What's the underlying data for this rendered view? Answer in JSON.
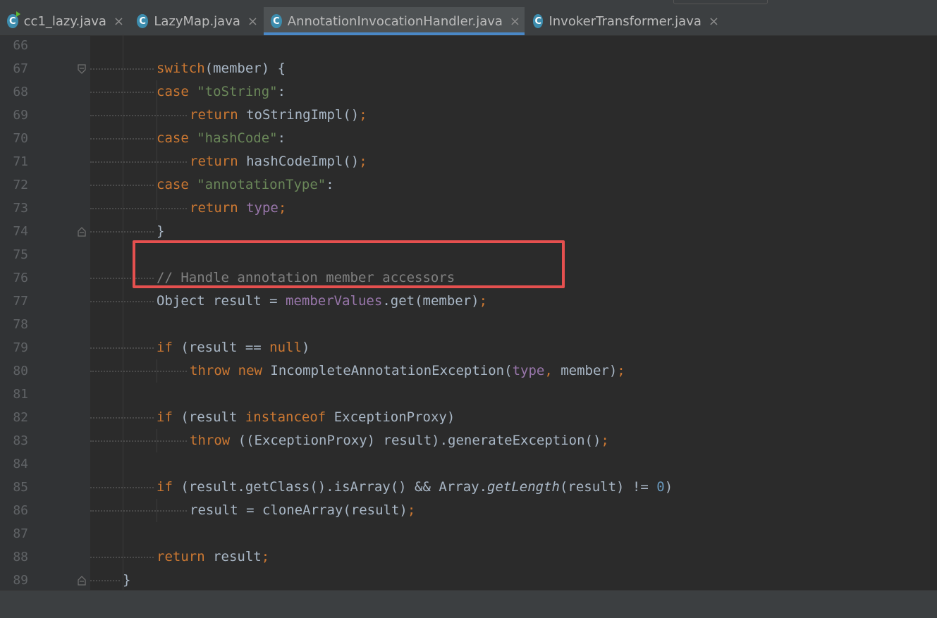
{
  "tabs": [
    {
      "label": "cc1_lazy.java",
      "icon": "class-run-icon",
      "active": false
    },
    {
      "label": "LazyMap.java",
      "icon": "class-icon",
      "active": false
    },
    {
      "label": "AnnotationInvocationHandler.java",
      "icon": "class-icon",
      "active": true
    },
    {
      "label": "InvokerTransformer.java",
      "icon": "class-icon",
      "active": false
    }
  ],
  "tab_close_glyph": "×",
  "class_icon_letter": "C",
  "colors": {
    "background": "#2b2b2b",
    "keyword": "#cc7832",
    "string": "#6a8759",
    "field": "#9876aa",
    "number": "#6897bb",
    "plain": "#a9b7c6",
    "line_number": "#606366",
    "highlight_box": "#e5504f",
    "active_tab_underline": "#4a88c7"
  },
  "lines": [
    {
      "n": "66",
      "tokens": []
    },
    {
      "n": "67",
      "tokens": [
        [
          "kw",
          "switch"
        ],
        [
          "p",
          "(member) {"
        ]
      ]
    },
    {
      "n": "68",
      "tokens": [
        [
          "kw",
          "case "
        ],
        [
          "str",
          "\"toString\""
        ],
        [
          "p",
          ":"
        ]
      ]
    },
    {
      "n": "69",
      "tokens": [
        [
          "kw",
          "return "
        ],
        [
          "p",
          "toStringImpl()"
        ],
        [
          "kw",
          ";"
        ]
      ]
    },
    {
      "n": "70",
      "tokens": [
        [
          "kw",
          "case "
        ],
        [
          "str",
          "\"hashCode\""
        ],
        [
          "p",
          ":"
        ]
      ]
    },
    {
      "n": "71",
      "tokens": [
        [
          "kw",
          "return "
        ],
        [
          "p",
          "hashCodeImpl()"
        ],
        [
          "kw",
          ";"
        ]
      ]
    },
    {
      "n": "72",
      "tokens": [
        [
          "kw",
          "case "
        ],
        [
          "str",
          "\"annotationType\""
        ],
        [
          "p",
          ":"
        ]
      ]
    },
    {
      "n": "73",
      "tokens": [
        [
          "kw",
          "return "
        ],
        [
          "fld",
          "type"
        ],
        [
          "kw",
          ";"
        ]
      ]
    },
    {
      "n": "74",
      "tokens": [
        [
          "p",
          "}"
        ]
      ]
    },
    {
      "n": "75",
      "tokens": []
    },
    {
      "n": "76",
      "tokens": [
        [
          "cmt",
          "// Handle annotation member accessors"
        ]
      ]
    },
    {
      "n": "77",
      "tokens": [
        [
          "p",
          "Object result = "
        ],
        [
          "fld",
          "memberValues"
        ],
        [
          "p",
          ".get(member)"
        ],
        [
          "kw",
          ";"
        ]
      ]
    },
    {
      "n": "78",
      "tokens": []
    },
    {
      "n": "79",
      "tokens": [
        [
          "kw",
          "if "
        ],
        [
          "p",
          "(result == "
        ],
        [
          "kw",
          "null"
        ],
        [
          "p",
          ")"
        ]
      ]
    },
    {
      "n": "80",
      "tokens": [
        [
          "kw",
          "throw new "
        ],
        [
          "p",
          "IncompleteAnnotationException("
        ],
        [
          "fld",
          "type"
        ],
        [
          "kw",
          ", "
        ],
        [
          "p",
          "member)"
        ],
        [
          "kw",
          ";"
        ]
      ]
    },
    {
      "n": "81",
      "tokens": []
    },
    {
      "n": "82",
      "tokens": [
        [
          "kw",
          "if "
        ],
        [
          "p",
          "(result "
        ],
        [
          "kw",
          "instanceof "
        ],
        [
          "p",
          "ExceptionProxy)"
        ]
      ]
    },
    {
      "n": "83",
      "tokens": [
        [
          "kw",
          "throw "
        ],
        [
          "p",
          "((ExceptionProxy) result).generateException()"
        ],
        [
          "kw",
          ";"
        ]
      ]
    },
    {
      "n": "84",
      "tokens": []
    },
    {
      "n": "85",
      "tokens": [
        [
          "kw",
          "if "
        ],
        [
          "p",
          "(result.getClass().isArray() && Array."
        ],
        [
          "ital",
          "getLength"
        ],
        [
          "p",
          "(result) != "
        ],
        [
          "num",
          "0"
        ],
        [
          "p",
          ")"
        ]
      ]
    },
    {
      "n": "86",
      "tokens": [
        [
          "p",
          "result = cloneArray(result)"
        ],
        [
          "kw",
          ";"
        ]
      ]
    },
    {
      "n": "87",
      "tokens": []
    },
    {
      "n": "88",
      "tokens": [
        [
          "kw",
          "return "
        ],
        [
          "p",
          "result"
        ],
        [
          "kw",
          ";"
        ]
      ]
    },
    {
      "n": "89",
      "tokens": [
        [
          "p",
          "}"
        ]
      ]
    }
  ]
}
